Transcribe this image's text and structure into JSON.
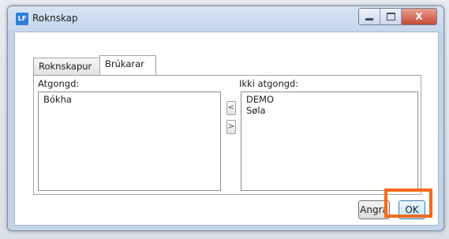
{
  "window": {
    "title": "Roknskap",
    "icon_text": "LF"
  },
  "tabs": [
    {
      "label": "Roknskapur",
      "active": false
    },
    {
      "label": "Brúkarar",
      "active": true
    }
  ],
  "panel": {
    "left_label": "Atgongd:",
    "right_label": "Ikki atgongd:",
    "left_items": [
      "Bókha"
    ],
    "right_items": [
      "DEMO",
      "Søla"
    ],
    "move_left": "<",
    "move_right": ">"
  },
  "buttons": {
    "cancel": "Angra",
    "ok": "OK"
  },
  "controls": {
    "close": "X"
  },
  "highlight_color": "#f26a1b"
}
